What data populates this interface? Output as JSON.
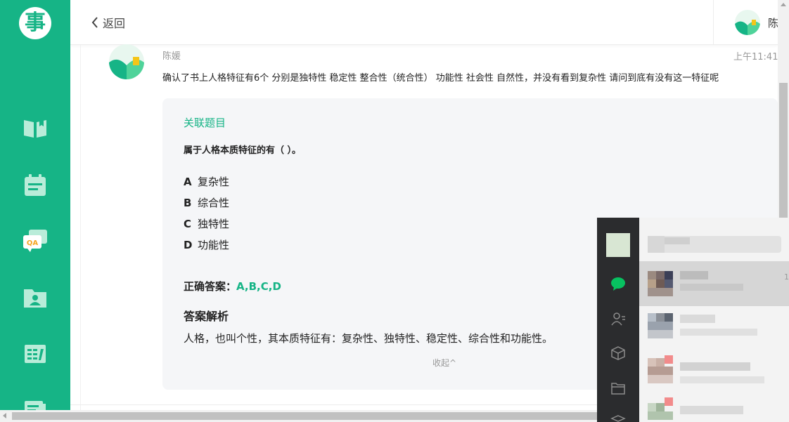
{
  "app": {
    "logo_char": "事",
    "nav_icons": [
      "book-icon",
      "calendar-icon",
      "qa-icon",
      "folder-user-icon",
      "calculator-icon",
      "document-icon"
    ]
  },
  "header": {
    "back_label": "返回",
    "user_name": "陈"
  },
  "message": {
    "author": "陈媛",
    "time": "上午11:41",
    "text": "确认了书上人格特征有6个 分别是独特性 稳定性 整合性（统合性） 功能性 社会性 自然性，并没有看到复杂性 请问到底有没有这一特征呢"
  },
  "question": {
    "section_label": "关联题目",
    "stem": "属于人格本质特征的有（ ）。",
    "options": [
      {
        "key": "A",
        "text": "复杂性"
      },
      {
        "key": "B",
        "text": "综合性"
      },
      {
        "key": "C",
        "text": "独特性"
      },
      {
        "key": "D",
        "text": "功能性"
      }
    ],
    "answer_label": "正确答案：",
    "answer_value": "A,B,C,D",
    "analysis_title": "答案解析",
    "analysis_text": "人格，也叫个性，其本质特征有：复杂性、独特性、稳定性、综合性和功能性。",
    "collapse_label": "收起^"
  },
  "chat_window": {
    "rail_icons": [
      "chat-bubble-icon",
      "contacts-icon",
      "cube-icon",
      "folder-icon",
      "box-icon"
    ],
    "partial_count": "1"
  },
  "colors": {
    "brand_green": "#16b486",
    "sidebar_bg": "#16b486",
    "chat_rail_bg": "#2b2c2e"
  }
}
